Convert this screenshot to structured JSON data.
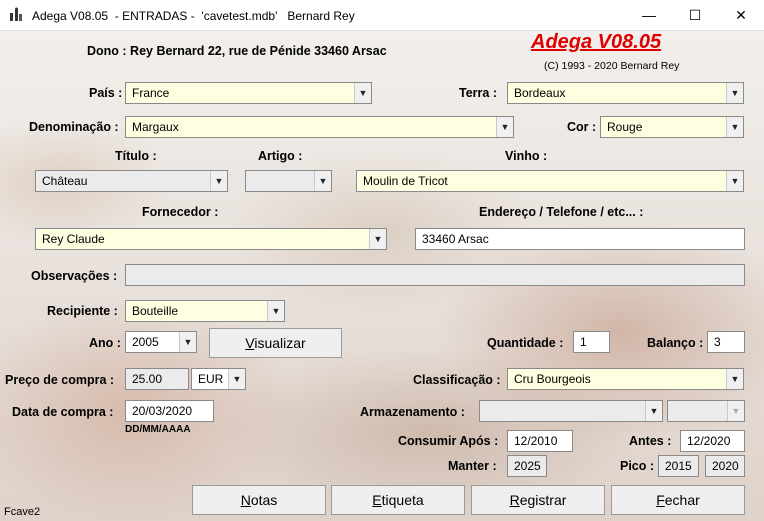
{
  "window": {
    "title": "Adega V08.05  - ENTRADAS -  'cavetest.mdb'   Bernard Rey",
    "minimize_glyph": "—",
    "maximize_glyph": "☐",
    "close_glyph": "✕",
    "icon": "wine-cellar-app-icon"
  },
  "header": {
    "owner": "Dono : Rey Bernard 22, rue de Pénide 33460 Arsac",
    "brand": "Adega V08.05",
    "copyright": "(C) 1993 - 2020 Bernard Rey"
  },
  "fields": {
    "pais": {
      "label": "País :",
      "value": "France"
    },
    "terra": {
      "label": "Terra :",
      "value": "Bordeaux"
    },
    "denominacao": {
      "label": "Denominação :",
      "value": "Margaux"
    },
    "cor": {
      "label": "Cor :",
      "value": "Rouge"
    },
    "titulo": {
      "label": "Título :",
      "value": "Château"
    },
    "artigo": {
      "label": "Artigo :",
      "value": ""
    },
    "vinho": {
      "label": "Vinho :",
      "value": "Moulin de Tricot"
    },
    "fornecedor": {
      "label": "Fornecedor :",
      "value": "Rey Claude"
    },
    "endereco": {
      "label": "Endereço / Telefone / etc... :",
      "value": "33460 Arsac"
    },
    "observacoes": {
      "label": "Observações :",
      "value": ""
    },
    "recipiente": {
      "label": "Recipiente :",
      "value": "Bouteille"
    },
    "ano": {
      "label": "Ano :",
      "value": "2005"
    },
    "quantidade": {
      "label": "Quantidade :",
      "value": "1"
    },
    "balanco": {
      "label": "Balanço :",
      "value": "3"
    },
    "preco": {
      "label": "Preço de compra :",
      "value": "25.00",
      "currency": "EUR"
    },
    "classificacao": {
      "label": "Classificação :",
      "value": "Cru Bourgeois"
    },
    "data_compra": {
      "label": "Data de compra :",
      "value": "20/03/2020",
      "format_hint": "DD/MM/AAAA"
    },
    "armazenamento": {
      "label": "Armazenamento :",
      "value": "",
      "value2": ""
    },
    "consumir_apos": {
      "label": "Consumir Após :",
      "value": "12/2010"
    },
    "antes": {
      "label": "Antes :",
      "value": "12/2020"
    },
    "manter": {
      "label": "Manter :",
      "value": "2025"
    },
    "pico": {
      "label": "Pico :",
      "value_from": "2015",
      "value_to": "2020"
    }
  },
  "buttons": {
    "visualizar": {
      "first": "V",
      "rest": "isualizar"
    },
    "notas": {
      "first": "N",
      "rest": "otas"
    },
    "etiqueta": {
      "first": "E",
      "rest": "tiqueta"
    },
    "registrar": {
      "first": "R",
      "rest": "egistrar"
    },
    "fechar": {
      "first": "F",
      "rest": "echar"
    }
  },
  "status": "Fcave2",
  "dropdown_glyph": "▼",
  "colors": {
    "input_bg": "#fefee0",
    "brand_red": "#e00000"
  }
}
